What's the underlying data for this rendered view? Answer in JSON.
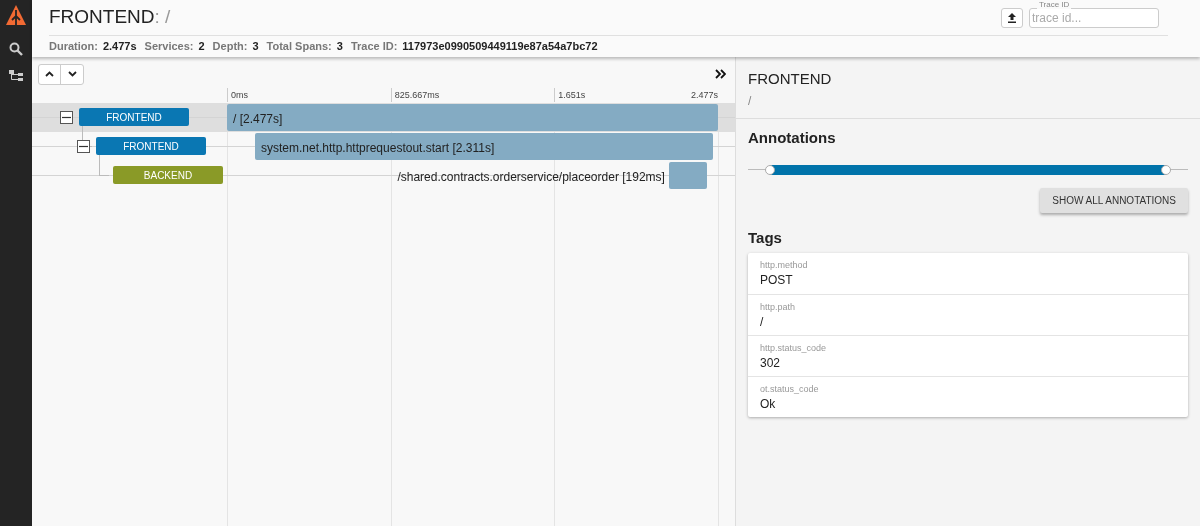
{
  "header": {
    "service": "FRONTEND",
    "path": ": /",
    "stats": [
      {
        "label": "Duration:",
        "value": "2.477s"
      },
      {
        "label": "Services:",
        "value": "2"
      },
      {
        "label": "Depth:",
        "value": "3"
      },
      {
        "label": "Total Spans:",
        "value": "3"
      },
      {
        "label": "Trace ID:",
        "value": "117973e0990509449119e87a54a7bc72"
      }
    ],
    "trace_field": {
      "label": "Trace ID",
      "placeholder": "trace id..."
    }
  },
  "timeline": {
    "ticks": [
      "0ms",
      "825.667ms",
      "1.651s",
      "2.477s"
    ],
    "spans": [
      {
        "service": "FRONTEND",
        "color": "#0a77b3",
        "label": "/ [2.477s]",
        "expanded": true,
        "selected": true,
        "children": [
          {
            "service": "FRONTEND",
            "color": "#0a77b3",
            "label": "system.net.http.httprequestout.start [2.311s]",
            "expanded": true,
            "selected": false,
            "children": [
              {
                "service": "BACKEND",
                "color": "#8a9a27",
                "label": "/shared.contracts.orderservice/placeorder [192ms]",
                "selected": false
              }
            ]
          }
        ]
      }
    ]
  },
  "detail": {
    "service": "FRONTEND",
    "path": "/",
    "annotations_title": "Annotations",
    "annotations_slider": {
      "level": 0.95
    },
    "show_all_button": "SHOW ALL ANNOTATIONS",
    "tags_title": "Tags",
    "tags": [
      {
        "key": "http.method",
        "value": "POST"
      },
      {
        "key": "http.path",
        "value": "/"
      },
      {
        "key": "http.status_code",
        "value": "302"
      },
      {
        "key": "ot.status_code",
        "value": "Ok"
      }
    ]
  }
}
